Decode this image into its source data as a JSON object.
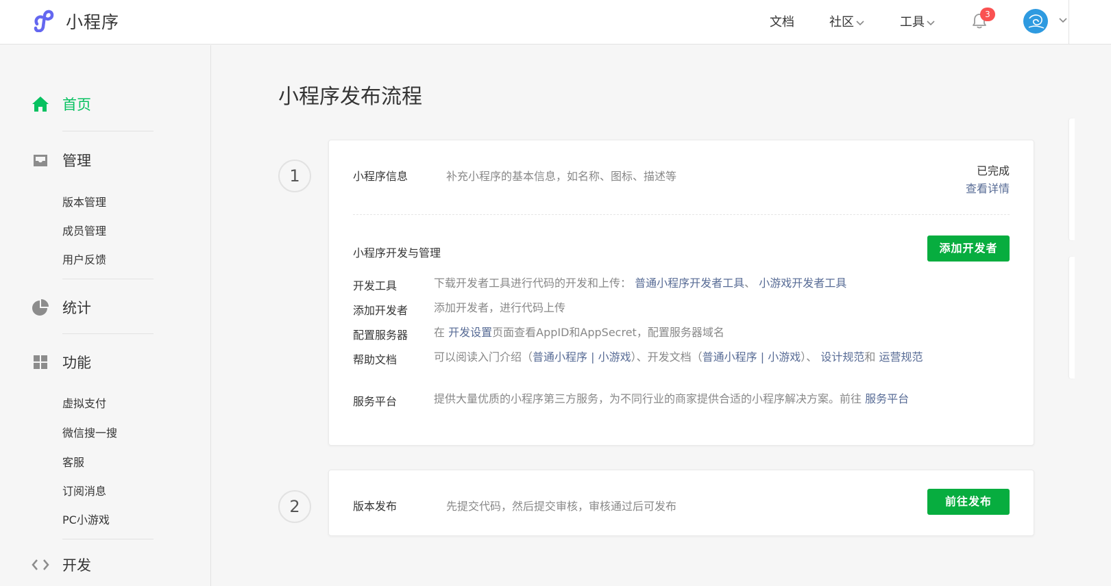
{
  "header": {
    "brand": "小程序",
    "nav": {
      "docs": "文档",
      "community": "社区",
      "tools": "工具"
    },
    "notification_count": "3",
    "brand_color": "#07c160"
  },
  "sidebar": {
    "home": "首页",
    "manage": {
      "label": "管理",
      "items": [
        "版本管理",
        "成员管理",
        "用户反馈"
      ]
    },
    "stats": "统计",
    "features": {
      "label": "功能",
      "items": [
        "虚拟支付",
        "微信搜一搜",
        "客服",
        "订阅消息",
        "PC小游戏"
      ]
    },
    "dev": "开发"
  },
  "main": {
    "title": "小程序发布流程",
    "step1": {
      "number": "1",
      "info_label": "小程序信息",
      "info_desc": "补充小程序的基本信息，如名称、图标、描述等",
      "status": "已完成",
      "detail_link": "查看详情",
      "dev_manage_label": "小程序开发与管理",
      "add_dev_button": "添加开发者",
      "rows": {
        "tools": {
          "label": "开发工具",
          "text": "下载开发者工具进行代码的开发和上传：",
          "link1": "普通小程序开发者工具",
          "sep": "、",
          "link2": "小游戏开发者工具"
        },
        "add_dev": {
          "label": "添加开发者",
          "text": "添加开发者，进行代码上传"
        },
        "server": {
          "label": "配置服务器",
          "pre": "在",
          "link": "开发设置",
          "post": "页面查看AppID和AppSecret，配置服务器域名"
        },
        "help": {
          "label": "帮助文档",
          "t1": "可以阅读入门介绍（",
          "l1": "普通小程序",
          "pipe1": " | ",
          "l2": "小游戏",
          "t2": "）、开发文档（",
          "l3": "普通小程序",
          "pipe2": " | ",
          "l4": "小游戏",
          "t3": "）、",
          "l5": "设计规范",
          "t4": "和",
          "l6": "运营规范"
        },
        "service": {
          "label": "服务平台",
          "text": "提供大量优质的小程序第三方服务，为不同行业的商家提供合适的小程序解决方案。前往",
          "link": "服务平台"
        }
      }
    },
    "step2": {
      "number": "2",
      "label": "版本发布",
      "desc": "先提交代码，然后提交审核，审核通过后可发布",
      "button": "前往发布"
    }
  }
}
